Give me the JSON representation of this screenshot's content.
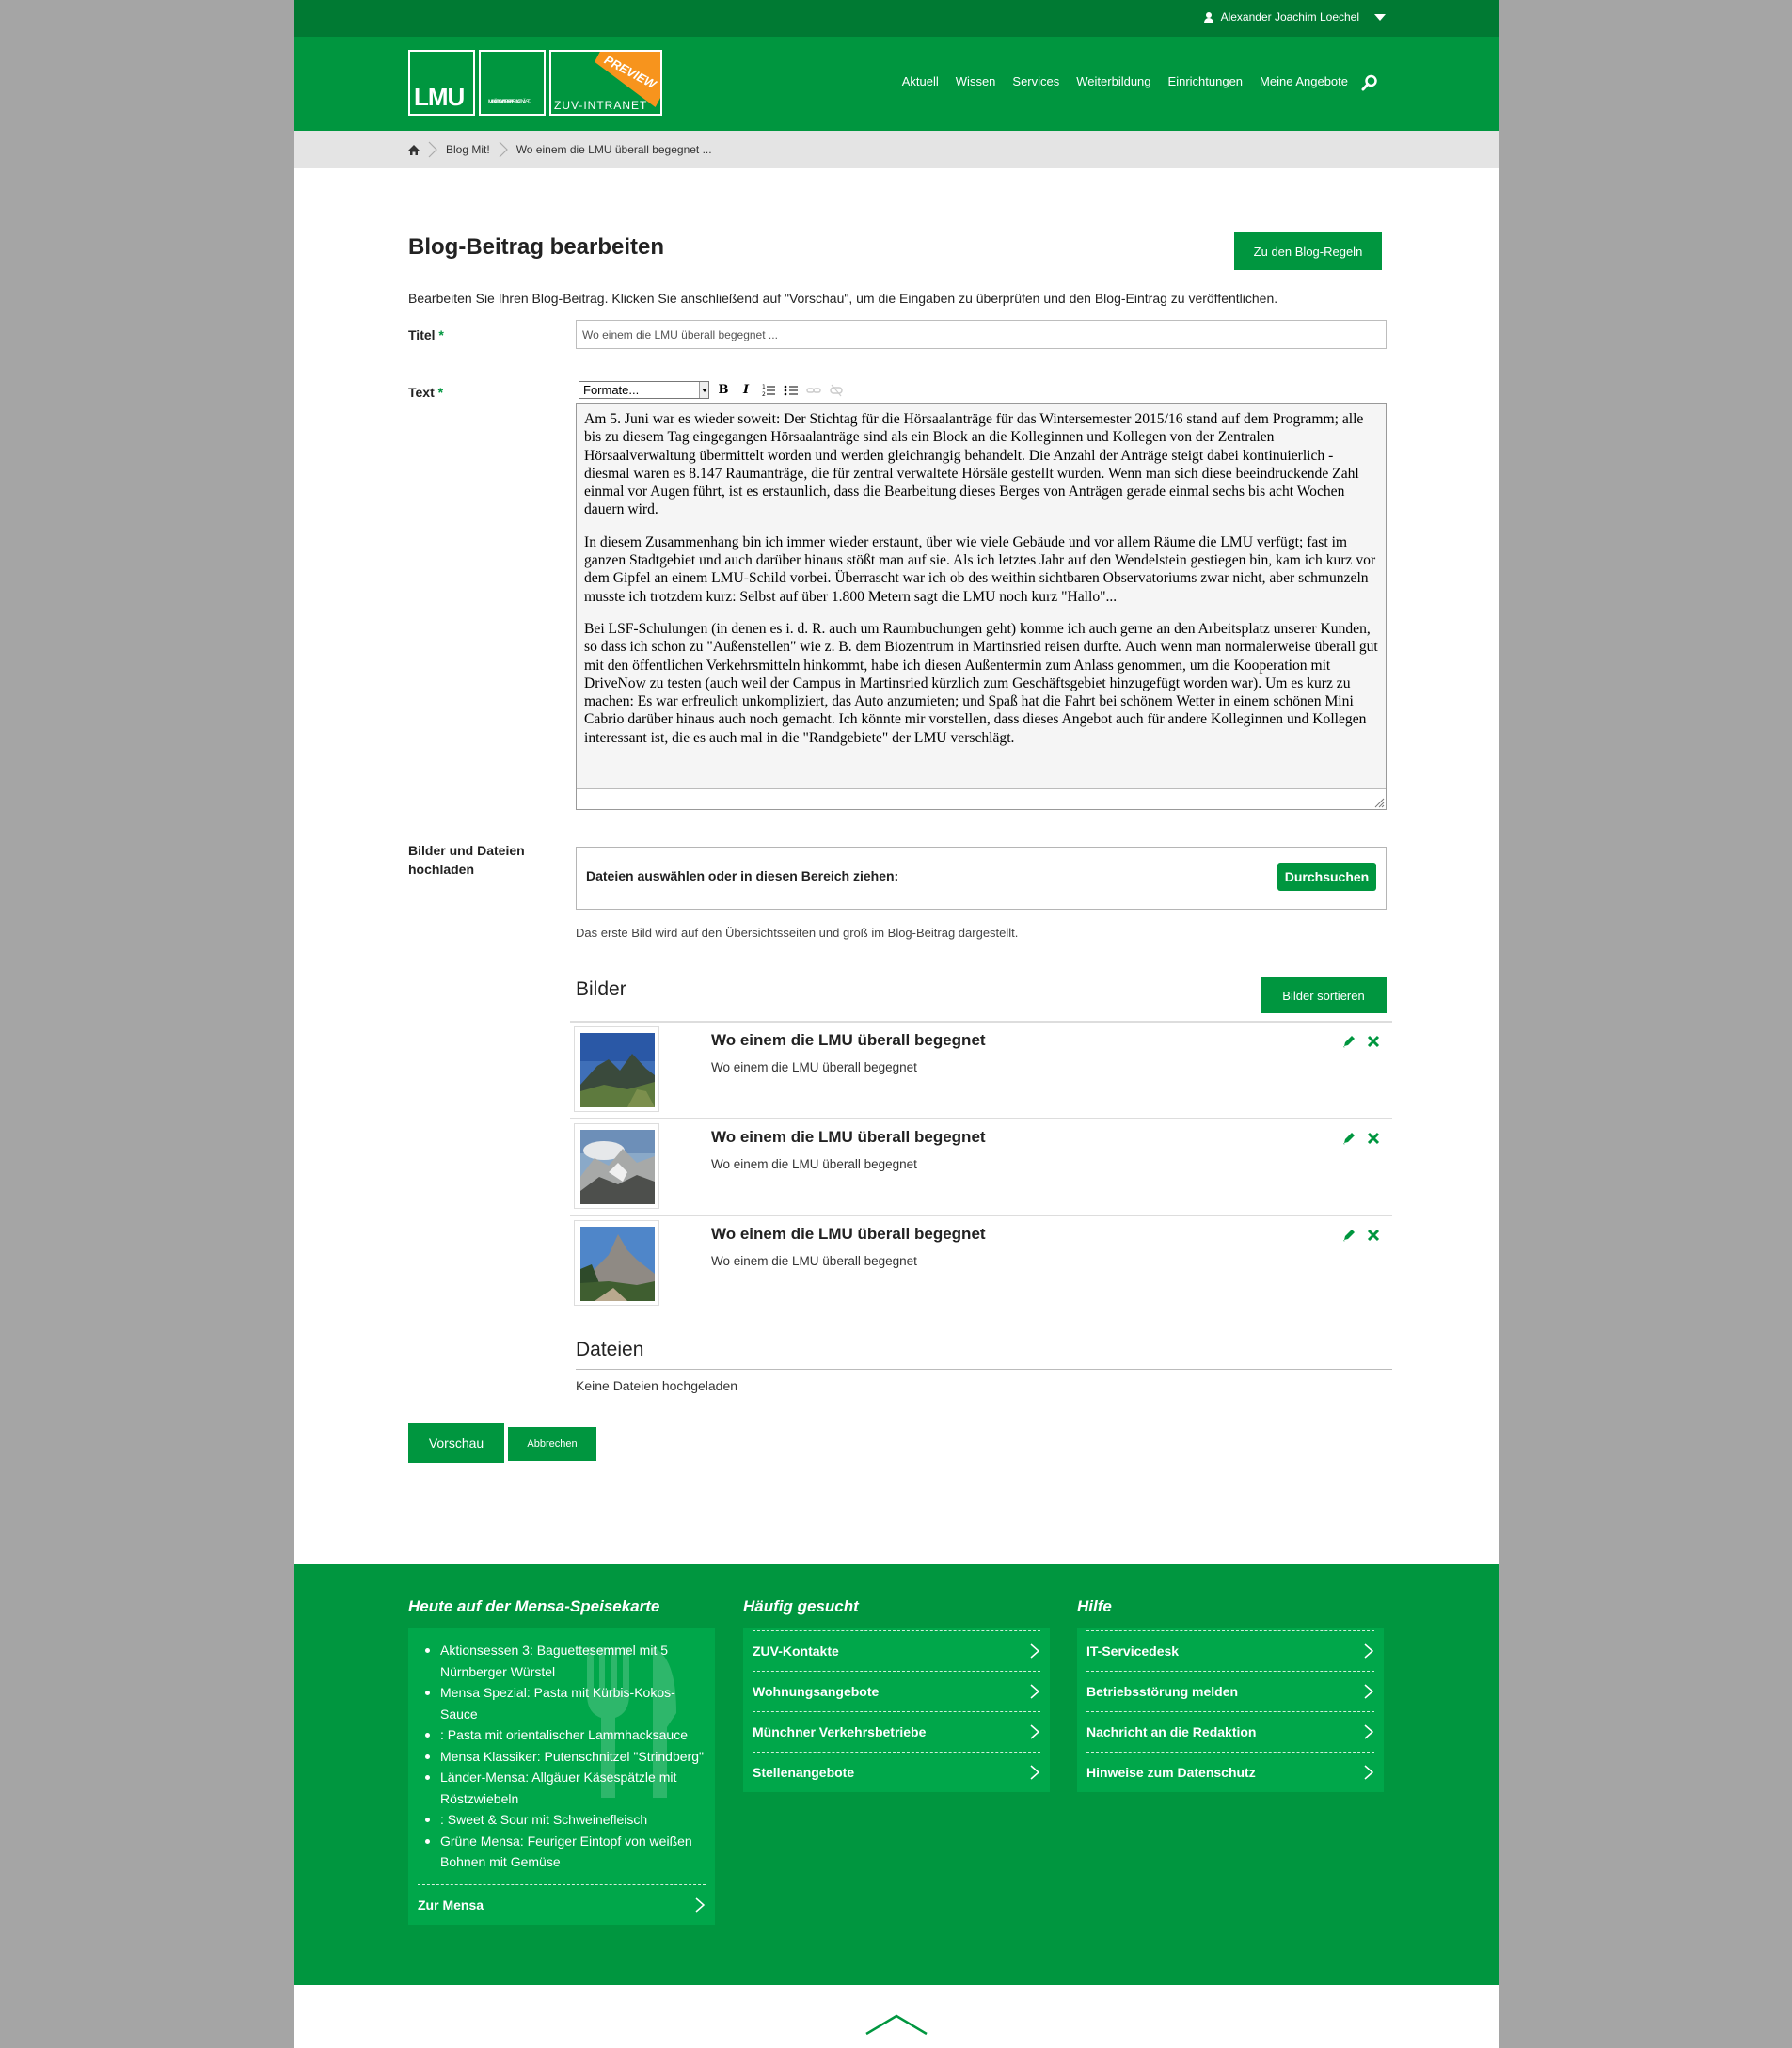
{
  "topbar": {
    "user_name": "Alexander Joachim Loechel"
  },
  "logo": {
    "lmu": "LMU",
    "uni_lines": [
      "Ludwig-",
      "Maximilians-",
      "Universität",
      "München"
    ],
    "zuv": "ZUV-INTRANET",
    "preview": "PREVIEW"
  },
  "nav": {
    "items": [
      "Aktuell",
      "Wissen",
      "Services",
      "Weiterbildung",
      "Einrichtungen",
      "Meine Angebote"
    ]
  },
  "breadcrumb": {
    "items": [
      "Blog Mit!",
      "Wo einem die LMU überall begegnet ..."
    ]
  },
  "page": {
    "title": "Blog-Beitrag bearbeiten",
    "rules_button": "Zu den Blog-Regeln",
    "intro": "Bearbeiten Sie Ihren Blog-Beitrag. Klicken Sie anschließend auf \"Vorschau\", um die Eingaben zu überprüfen und den Blog-Eintrag zu veröffentlichen."
  },
  "form": {
    "title_label": "Titel",
    "title_value": "Wo einem die LMU überall begegnet ...",
    "required_mark": "*",
    "text_label": "Text",
    "format_select": "Formate...",
    "text_paragraphs": [
      "Am 5. Juni war es wieder soweit: Der Stichtag für die Hörsaalanträge für das Wintersemester 2015/16 stand auf dem Programm; alle bis zu diesem Tag eingegangen Hörsaalanträge sind als ein Block an die Kolleginnen und Kollegen von der Zentralen Hörsaalverwaltung übermittelt worden und werden gleichrangig behandelt. Die Anzahl der Anträge steigt dabei kontinuierlich - diesmal waren es 8.147 Raumanträge, die für zentral verwaltete Hörsäle gestellt wurden. Wenn man sich diese beeindruckende Zahl einmal vor Augen führt, ist es erstaunlich, dass die Bearbeitung dieses Berges von Anträgen gerade einmal sechs bis acht Wochen dauern wird.",
      "In diesem Zusammenhang bin ich immer wieder erstaunt, über wie viele Gebäude und vor allem Räume die LMU verfügt; fast im ganzen Stadtgebiet und auch darüber hinaus stößt man auf sie. Als ich letztes Jahr auf den Wendelstein gestiegen bin, kam ich kurz vor dem Gipfel an einem LMU-Schild vorbei. Überrascht war ich ob des weithin sichtbaren Observatoriums zwar nicht, aber schmunzeln musste ich trotzdem kurz: Selbst auf über 1.800 Metern sagt die LMU noch kurz \"Hallo\"...",
      "Bei LSF-Schulungen (in denen es i. d. R. auch um Raumbuchungen geht) komme ich auch gerne an den Arbeitsplatz unserer Kunden, so dass ich schon zu \"Außenstellen\" wie z. B. dem Biozentrum in Martinsried reisen durfte. Auch wenn man normalerweise überall gut mit den öffentlichen Verkehrsmitteln hinkommt, habe ich diesen Außentermin zum Anlass genommen, um die Kooperation mit DriveNow zu testen (auch weil der Campus in Martinsried kürzlich zum Geschäftsgebiet hinzugefügt worden war). Um es kurz zu machen: Es war erfreulich unkompliziert, das Auto anzumieten; und Spaß hat die Fahrt bei schönem Wetter in einem schönen Mini Cabrio darüber hinaus auch noch gemacht. Ich könnte mir vorstellen, dass dieses Angebot auch für andere Kolleginnen und Kollegen interessant ist, die es auch mal in die \"Randgebiete\" der LMU verschlägt."
    ],
    "upload_label": "Bilder und Dateien hochladen",
    "upload_text": "Dateien auswählen oder in diesen Bereich ziehen:",
    "browse_button": "Durchsuchen",
    "upload_hint": "Das erste Bild wird auf den Übersichtsseiten und groß im Blog-Beitrag dargestellt."
  },
  "images": {
    "heading": "Bilder",
    "sort_button": "Bilder sortieren",
    "items": [
      {
        "title": "Wo einem die LMU überall begegnet",
        "desc": "Wo einem die LMU überall begegnet"
      },
      {
        "title": "Wo einem die LMU überall begegnet",
        "desc": "Wo einem die LMU überall begegnet"
      },
      {
        "title": "Wo einem die LMU überall begegnet",
        "desc": "Wo einem die LMU überall begegnet"
      }
    ]
  },
  "files": {
    "heading": "Dateien",
    "empty": "Keine Dateien hochgeladen"
  },
  "actions": {
    "preview": "Vorschau",
    "cancel": "Abbrechen"
  },
  "footer": {
    "mensa": {
      "heading": "Heute auf der Mensa-Speisekarte",
      "items": [
        "Aktionsessen 3: Baguettesemmel mit 5 Nürnberger Würstel",
        "Mensa Spezial: Pasta mit Kürbis-Kokos-Sauce",
        ": Pasta mit orientalischer Lammhacksauce",
        "Mensa Klassiker: Putenschnitzel \"Strindberg\"",
        "Länder-Mensa: Allgäuer Käsespätzle mit Röstzwiebeln",
        ": Sweet & Sour mit Schweinefleisch",
        "Grüne Mensa: Feuriger Eintopf von weißen Bohnen mit Gemüse"
      ],
      "link": "Zur Mensa"
    },
    "frequent": {
      "heading": "Häufig gesucht",
      "links": [
        "ZUV-Kontakte",
        "Wohnungsangebote",
        "Münchner Verkehrsbetriebe",
        "Stellenangebote"
      ]
    },
    "help": {
      "heading": "Hilfe",
      "links": [
        "IT-Servicedesk",
        "Betriebsstörung melden",
        "Nachricht an die Redaktion",
        "Hinweise zum Datenschutz"
      ]
    }
  },
  "colors": {
    "brand_green": "#00963f",
    "dark_green": "#007a33",
    "footer_box": "#00a74a",
    "preview_orange": "#f7941d"
  }
}
